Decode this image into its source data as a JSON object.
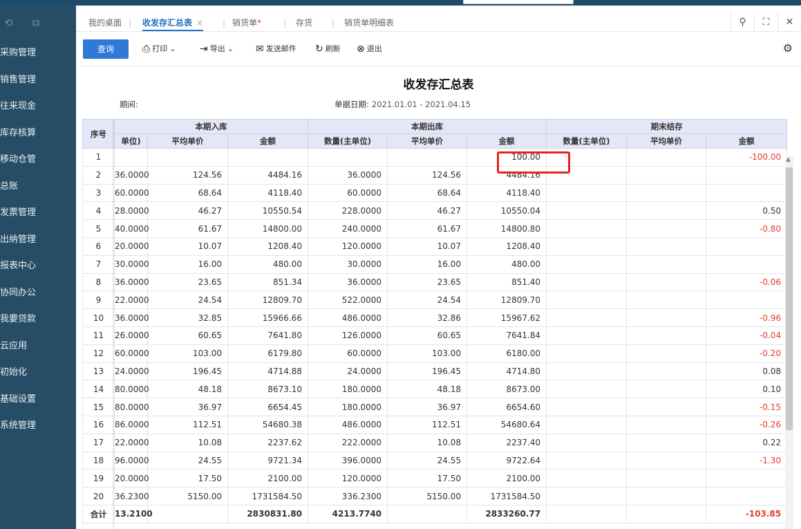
{
  "topbar": {
    "brand": ""
  },
  "sidebar": {
    "items": [
      {
        "label": "采购管理"
      },
      {
        "label": "销售管理"
      },
      {
        "label": "往来现金"
      },
      {
        "label": "库存核算"
      },
      {
        "label": "移动仓管"
      },
      {
        "label": "总账"
      },
      {
        "label": "发票管理"
      },
      {
        "label": "出纳管理"
      },
      {
        "label": "报表中心"
      },
      {
        "label": "协同办公"
      },
      {
        "label": "我要贷款"
      },
      {
        "label": "云应用"
      },
      {
        "label": "初始化"
      },
      {
        "label": "基础设置"
      },
      {
        "label": "系统管理"
      }
    ]
  },
  "tabs": [
    {
      "label": "我的桌面"
    },
    {
      "label": "收发存汇总表",
      "close": "×"
    },
    {
      "label": "销货单",
      "dirty": "*"
    },
    {
      "label": "存货"
    },
    {
      "label": "销货单明细表"
    }
  ],
  "toolbar": {
    "query": "查询",
    "print": "打印",
    "export": "导出",
    "email": "发送邮件",
    "refresh": "刷新",
    "exit": "退出"
  },
  "report": {
    "title": "收发存汇总表",
    "period_label": "期间:",
    "date_label": "单据日期:",
    "date_value": "2021.01.01 - 2021.04.15"
  },
  "table": {
    "group_headers": [
      "本期入库",
      "本期出库",
      "期末结存"
    ],
    "index_header": "序号",
    "sub_headers": [
      "单位)",
      "平均单价",
      "金额",
      "数量(主单位)",
      "平均单价",
      "金额",
      "数量(主单位)",
      "平均单价",
      "金额"
    ],
    "rows": [
      [
        "1",
        "",
        "",
        "",
        "",
        "",
        "100.00",
        "",
        "",
        "-100.00"
      ],
      [
        "2",
        "36.0000",
        "124.56",
        "4484.16",
        "36.0000",
        "124.56",
        "4484.16",
        "",
        "",
        ""
      ],
      [
        "3",
        "60.0000",
        "68.64",
        "4118.40",
        "60.0000",
        "68.64",
        "4118.40",
        "",
        "",
        ""
      ],
      [
        "4",
        "28.0000",
        "46.27",
        "10550.54",
        "228.0000",
        "46.27",
        "10550.04",
        "",
        "",
        "0.50"
      ],
      [
        "5",
        "40.0000",
        "61.67",
        "14800.00",
        "240.0000",
        "61.67",
        "14800.80",
        "",
        "",
        "-0.80"
      ],
      [
        "6",
        "20.0000",
        "10.07",
        "1208.40",
        "120.0000",
        "10.07",
        "1208.40",
        "",
        "",
        ""
      ],
      [
        "7",
        "30.0000",
        "16.00",
        "480.00",
        "30.0000",
        "16.00",
        "480.00",
        "",
        "",
        ""
      ],
      [
        "8",
        "36.0000",
        "23.65",
        "851.34",
        "36.0000",
        "23.65",
        "851.40",
        "",
        "",
        "-0.06"
      ],
      [
        "9",
        "22.0000",
        "24.54",
        "12809.70",
        "522.0000",
        "24.54",
        "12809.70",
        "",
        "",
        ""
      ],
      [
        "10",
        "36.0000",
        "32.85",
        "15966.66",
        "486.0000",
        "32.86",
        "15967.62",
        "",
        "",
        "-0.96"
      ],
      [
        "11",
        "26.0000",
        "60.65",
        "7641.80",
        "126.0000",
        "60.65",
        "7641.84",
        "",
        "",
        "-0.04"
      ],
      [
        "12",
        "60.0000",
        "103.00",
        "6179.80",
        "60.0000",
        "103.00",
        "6180.00",
        "",
        "",
        "-0.20"
      ],
      [
        "13",
        "24.0000",
        "196.45",
        "4714.88",
        "24.0000",
        "196.45",
        "4714.80",
        "",
        "",
        "0.08"
      ],
      [
        "14",
        "80.0000",
        "48.18",
        "8673.10",
        "180.0000",
        "48.18",
        "8673.00",
        "",
        "",
        "0.10"
      ],
      [
        "15",
        "80.0000",
        "36.97",
        "6654.45",
        "180.0000",
        "36.97",
        "6654.60",
        "",
        "",
        "-0.15"
      ],
      [
        "16",
        "86.0000",
        "112.51",
        "54680.38",
        "486.0000",
        "112.51",
        "54680.64",
        "",
        "",
        "-0.26"
      ],
      [
        "17",
        "22.0000",
        "10.08",
        "2237.62",
        "222.0000",
        "10.08",
        "2237.40",
        "",
        "",
        "0.22"
      ],
      [
        "18",
        "96.0000",
        "24.55",
        "9721.34",
        "396.0000",
        "24.55",
        "9722.64",
        "",
        "",
        "-1.30"
      ],
      [
        "19",
        "20.0000",
        "17.50",
        "2100.00",
        "120.0000",
        "17.50",
        "2100.00",
        "",
        "",
        ""
      ],
      [
        "20",
        "36.2300",
        "5150.00",
        "1731584.50",
        "336.2300",
        "5150.00",
        "1731584.50",
        "",
        "",
        ""
      ]
    ],
    "total": [
      "合计",
      "13.2100",
      "",
      "2830831.80",
      "4213.7740",
      "",
      "2833260.77",
      "",
      "",
      "-103.85"
    ]
  },
  "colors": {
    "accent": "#2e7ad6",
    "sidebar": "#264d65",
    "negative": "#e33b2f",
    "highlight": "#e8231a",
    "header_bg": "#e4e7f7"
  },
  "icons": [
    "refresh-icon",
    "minimize-icon",
    "search-icon",
    "fullscreen-icon",
    "close-icon",
    "print-icon",
    "export-icon",
    "email-icon",
    "exit-icon",
    "gear-icon"
  ]
}
